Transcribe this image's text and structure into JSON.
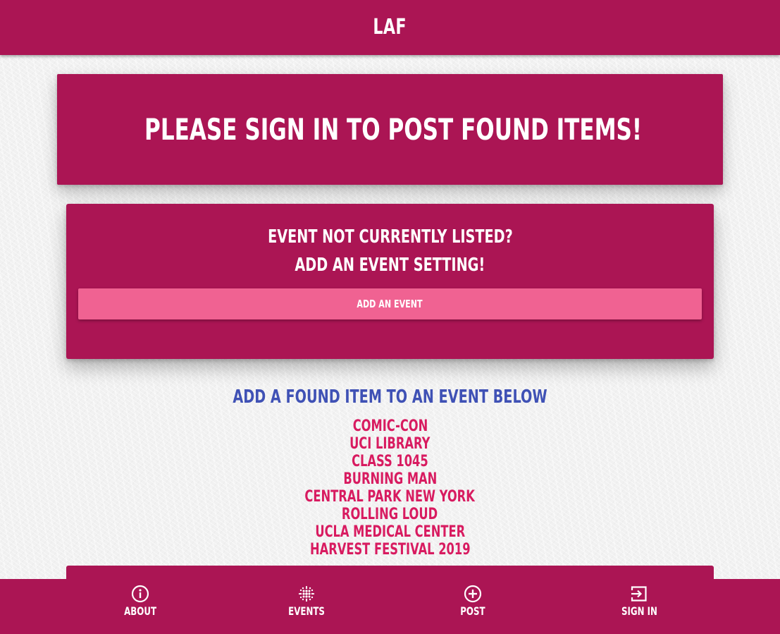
{
  "header": {
    "title": "LAF"
  },
  "signin_banner": {
    "text": "Please sign in to post found items!"
  },
  "add_event_card": {
    "line1": "Event not currently listed?",
    "line2": "Add an event setting!",
    "button_label": "Add an event"
  },
  "found_items": {
    "heading": "Add a found item to an event below",
    "events": [
      "Comic-Con",
      "UCI Library",
      "Class 1045",
      "Burning Man",
      "Central Park New York",
      "Rolling Loud",
      "UCLA Medical Center",
      "Harvest Festival 2019"
    ]
  },
  "bottom_nav": {
    "items": [
      {
        "label": "About",
        "icon": "info-icon"
      },
      {
        "label": "Events",
        "icon": "events-dots-icon"
      },
      {
        "label": "Post",
        "icon": "add-circle-icon"
      },
      {
        "label": "Sign in",
        "icon": "sign-in-icon"
      }
    ]
  },
  "colors": {
    "primary": "#ab1554",
    "button_pink": "#f06292",
    "heading_blue": "#3f51b5",
    "link_pink": "#d81b60",
    "background": "#f1f1f1"
  }
}
